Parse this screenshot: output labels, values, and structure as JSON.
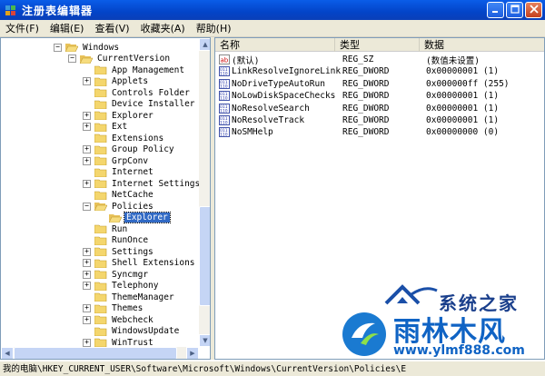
{
  "window": {
    "title": "注册表编辑器"
  },
  "menu": [
    "文件(F)",
    "编辑(E)",
    "查看(V)",
    "收藏夹(A)",
    "帮助(H)"
  ],
  "tree": [
    {
      "label": "Windows",
      "expander": "-",
      "indent": 0,
      "selected": false
    },
    {
      "label": "CurrentVersion",
      "expander": "-",
      "indent": 1,
      "selected": false
    },
    {
      "label": "App Management",
      "expander": "",
      "indent": 2,
      "selected": false
    },
    {
      "label": "Applets",
      "expander": "+",
      "indent": 2,
      "selected": false
    },
    {
      "label": "Controls Folder",
      "expander": "",
      "indent": 2,
      "selected": false
    },
    {
      "label": "Device Installer",
      "expander": "",
      "indent": 2,
      "selected": false
    },
    {
      "label": "Explorer",
      "expander": "+",
      "indent": 2,
      "selected": false
    },
    {
      "label": "Ext",
      "expander": "+",
      "indent": 2,
      "selected": false
    },
    {
      "label": "Extensions",
      "expander": "",
      "indent": 2,
      "selected": false
    },
    {
      "label": "Group Policy",
      "expander": "+",
      "indent": 2,
      "selected": false
    },
    {
      "label": "GrpConv",
      "expander": "+",
      "indent": 2,
      "selected": false
    },
    {
      "label": "Internet",
      "expander": "",
      "indent": 2,
      "selected": false
    },
    {
      "label": "Internet Settings",
      "expander": "+",
      "indent": 2,
      "selected": false
    },
    {
      "label": "NetCache",
      "expander": "",
      "indent": 2,
      "selected": false
    },
    {
      "label": "Policies",
      "expander": "-",
      "indent": 2,
      "selected": false
    },
    {
      "label": "Explorer",
      "expander": "",
      "indent": 3,
      "selected": true
    },
    {
      "label": "Run",
      "expander": "",
      "indent": 2,
      "selected": false
    },
    {
      "label": "RunOnce",
      "expander": "",
      "indent": 2,
      "selected": false
    },
    {
      "label": "Settings",
      "expander": "+",
      "indent": 2,
      "selected": false
    },
    {
      "label": "Shell Extensions",
      "expander": "+",
      "indent": 2,
      "selected": false
    },
    {
      "label": "Syncmgr",
      "expander": "+",
      "indent": 2,
      "selected": false
    },
    {
      "label": "Telephony",
      "expander": "+",
      "indent": 2,
      "selected": false
    },
    {
      "label": "ThemeManager",
      "expander": "",
      "indent": 2,
      "selected": false
    },
    {
      "label": "Themes",
      "expander": "+",
      "indent": 2,
      "selected": false
    },
    {
      "label": "Webcheck",
      "expander": "+",
      "indent": 2,
      "selected": false
    },
    {
      "label": "WindowsUpdate",
      "expander": "",
      "indent": 2,
      "selected": false
    },
    {
      "label": "WinTrust",
      "expander": "+",
      "indent": 2,
      "selected": false
    }
  ],
  "columns": [
    "名称",
    "类型",
    "数据"
  ],
  "values": [
    {
      "icon": "string-value-icon",
      "name": "(默认)",
      "type": "REG_SZ",
      "data": "(数值未设置)"
    },
    {
      "icon": "binary-value-icon",
      "name": "LinkResolveIgnoreLink...",
      "type": "REG_DWORD",
      "data": "0x00000001 (1)"
    },
    {
      "icon": "binary-value-icon",
      "name": "NoDriveTypeAutoRun",
      "type": "REG_DWORD",
      "data": "0x000000ff (255)"
    },
    {
      "icon": "binary-value-icon",
      "name": "NoLowDiskSpaceChecks",
      "type": "REG_DWORD",
      "data": "0x00000001 (1)"
    },
    {
      "icon": "binary-value-icon",
      "name": "NoResolveSearch",
      "type": "REG_DWORD",
      "data": "0x00000001 (1)"
    },
    {
      "icon": "binary-value-icon",
      "name": "NoResolveTrack",
      "type": "REG_DWORD",
      "data": "0x00000001 (1)"
    },
    {
      "icon": "binary-value-icon",
      "name": "NoSMHelp",
      "type": "REG_DWORD",
      "data": "0x00000000 (0)"
    }
  ],
  "statusbar": "我的电脑\\HKEY_CURRENT_USER\\Software\\Microsoft\\Windows\\CurrentVersion\\Policies\\E",
  "watermark": {
    "top": "系统之家",
    "brand": "雨林木风",
    "url": "www.ylmf888.com"
  }
}
